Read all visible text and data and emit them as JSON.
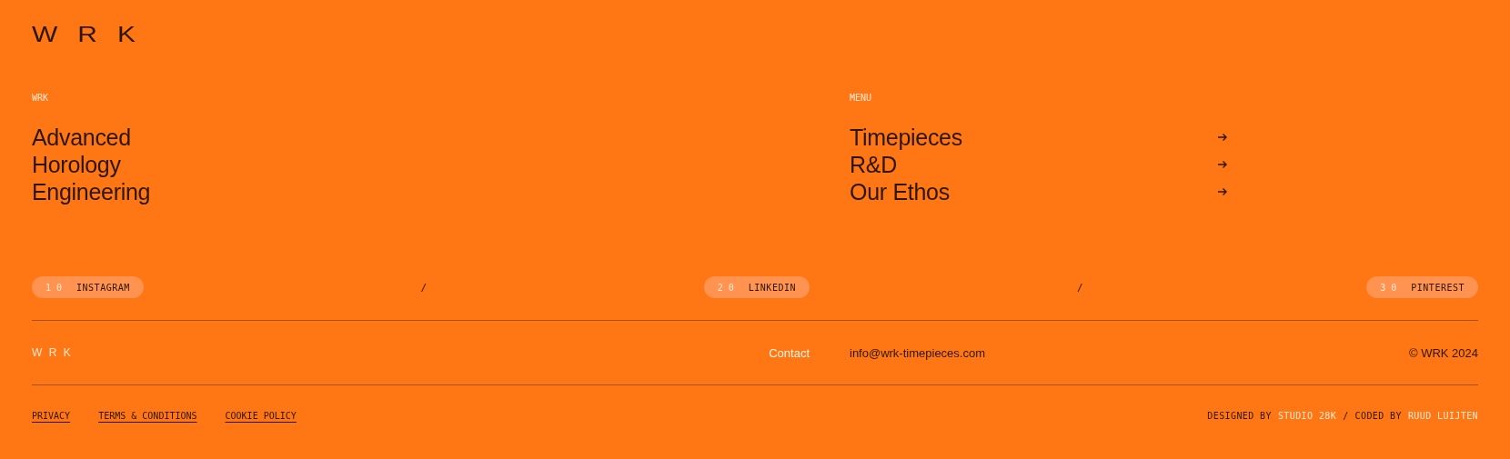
{
  "logo": {
    "text": "WRK"
  },
  "about": {
    "label": "WRK",
    "lines": [
      "Advanced",
      "Horology",
      "Engineering"
    ]
  },
  "menu": {
    "label": "MENU",
    "items": [
      {
        "label": "Timepieces"
      },
      {
        "label": "R&D"
      },
      {
        "label": "Our Ethos"
      }
    ]
  },
  "socials": [
    {
      "number": "1 0",
      "label": "INSTAGRAM"
    },
    {
      "number": "2 0",
      "label": "LINKEDIN"
    },
    {
      "number": "3 0",
      "label": "PINTEREST"
    }
  ],
  "separator": "/",
  "footer": {
    "brand": "W R K",
    "contact_label": "Contact",
    "email": "info@wrk-timepieces.com",
    "copyright": "© WRK 2024"
  },
  "legal_links": [
    "PRIVACY",
    "TERMS & CONDITIONS",
    "COOKIE POLICY"
  ],
  "credits": [
    {
      "text": "DESIGNED BY",
      "kind": "plain"
    },
    {
      "text": "STUDIO 28K",
      "kind": "link"
    },
    {
      "text": "/",
      "kind": "plain"
    },
    {
      "text": "CODED BY",
      "kind": "plain"
    },
    {
      "text": "RUUD LUIJTEN",
      "kind": "link"
    }
  ]
}
